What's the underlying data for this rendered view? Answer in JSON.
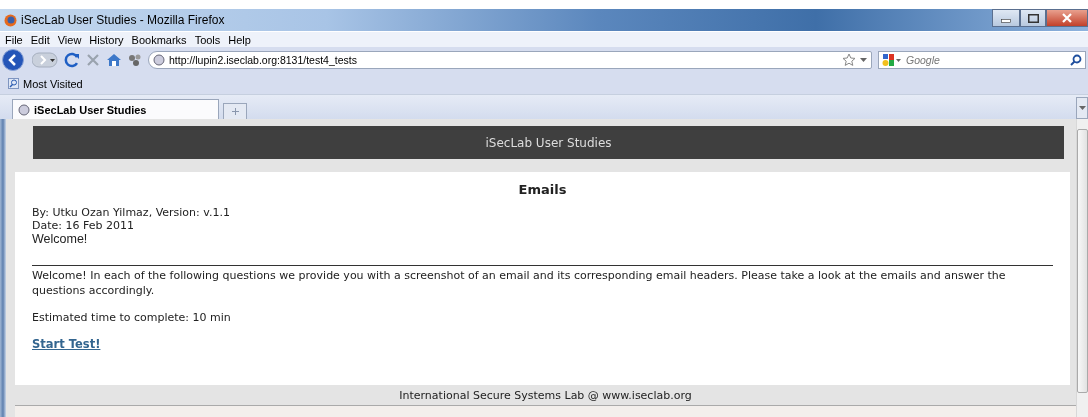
{
  "window": {
    "title": "iSecLab User Studies - Mozilla Firefox"
  },
  "menu": [
    "File",
    "Edit",
    "View",
    "History",
    "Bookmarks",
    "Tools",
    "Help"
  ],
  "address": {
    "value": "http://lupin2.iseclab.org:8131/test4_tests"
  },
  "search": {
    "placeholder": "Google"
  },
  "bookmarks": [
    "Most Visited"
  ],
  "tabs": [
    {
      "label": "iSecLab User Studies",
      "selected": true
    }
  ],
  "page": {
    "header": "iSecLab User Studies",
    "heading": "Emails",
    "byline": "By: Utku Ozan Yilmaz, Version: v.1.1",
    "date": "Date: 16 Feb 2011",
    "welcome": "Welcome!",
    "intro": "Welcome! In each of the following questions we provide you with a screenshot of an email and its corresponding email headers. Please take a look at the emails and answer the questions accordingly.",
    "estimate": "Estimated time to complete: 10 min",
    "link": "Start Test!",
    "footer": "International Secure Systems Lab @ www.iseclab.org"
  }
}
